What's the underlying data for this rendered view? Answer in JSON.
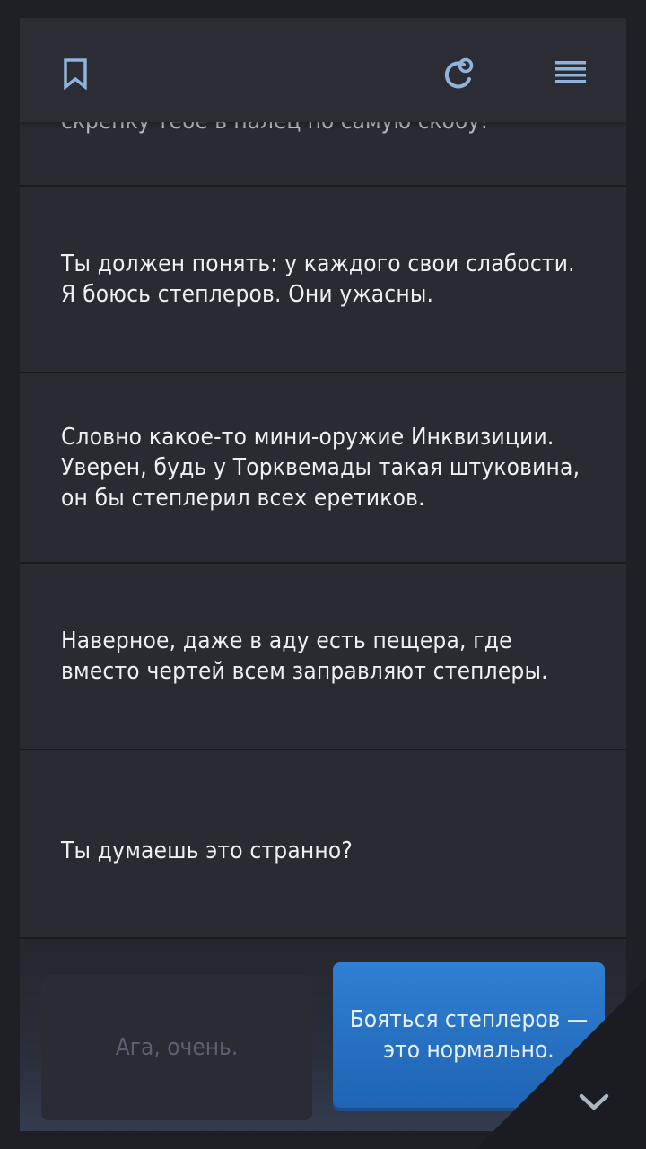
{
  "header": {
    "bookmark_icon": "bookmark-icon",
    "restart_icon": "restart-icon",
    "menu_icon": "menu-icon"
  },
  "messages": [
    {
      "text": "скрепку тебе в палец по самую скобу!"
    },
    {
      "text": "Ты должен понять: у каждого свои слабости. Я боюсь степлеров. Они ужасны."
    },
    {
      "text": "Словно какое-то мини-оружие Инквизиции. Уверен, будь у Торквемады такая штуковина, он бы степлерил всех еретиков."
    },
    {
      "text": "Наверное, даже в аду есть пещера, где вместо чертей всем заправляют степлеры."
    },
    {
      "text": "Ты думаешь это странно?"
    }
  ],
  "choices": [
    {
      "label": "Ага, очень."
    },
    {
      "label": "Бояться степлеров — это нормально."
    }
  ],
  "colors": {
    "background": "#2a2a32",
    "accent": "#2f7fd2"
  }
}
